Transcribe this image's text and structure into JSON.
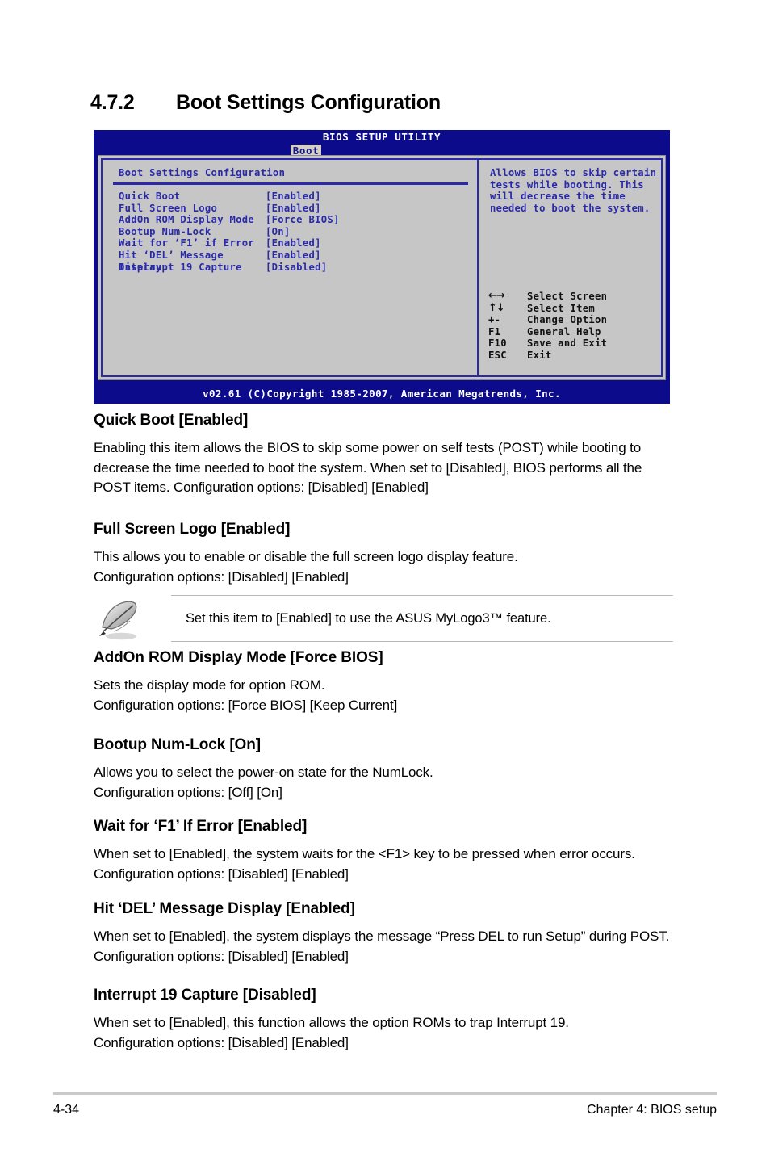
{
  "section": {
    "number": "4.7.2",
    "title": "Boot Settings Configuration"
  },
  "bios": {
    "title": "BIOS SETUP UTILITY",
    "tab": "Boot",
    "panel_heading": "Boot Settings Configuration",
    "settings": [
      {
        "label": "Quick Boot",
        "value": "[Enabled]"
      },
      {
        "label": "Full Screen Logo",
        "value": "[Enabled]"
      },
      {
        "label": "AddOn ROM Display Mode",
        "value": "[Force BIOS]"
      },
      {
        "label": "Bootup Num-Lock",
        "value": "[On]"
      },
      {
        "label": "Wait for ‘F1’ if Error",
        "value": "[Enabled]"
      },
      {
        "label": "Hit ‘DEL’ Message Display",
        "value": "[Enabled]"
      },
      {
        "label": "Interrupt 19 Capture",
        "value": "[Disabled]"
      }
    ],
    "help": "Allows BIOS to skip certain tests while booting. This will decrease the time needed to boot the system.",
    "legend": [
      {
        "key": "←→",
        "desc": "Select Screen",
        "icon": "left-right-arrow-icon"
      },
      {
        "key": "↑↓",
        "desc": "Select Item",
        "icon": "up-down-arrow-icon"
      },
      {
        "key": "+-",
        "desc": "Change Option",
        "icon": "plus-minus-icon"
      },
      {
        "key": "F1",
        "desc": "General Help",
        "icon": ""
      },
      {
        "key": "F10",
        "desc": "Save and Exit",
        "icon": ""
      },
      {
        "key": "ESC",
        "desc": "Exit",
        "icon": ""
      }
    ],
    "footer": "v02.61 (C)Copyright 1985-2007, American Megatrends, Inc.",
    "colors": {
      "chrome_blue": "#0b0b8c",
      "panel_gray": "#c6c6c6",
      "text_blue": "#2a2aa8",
      "tab_bg": "#d4d0c8"
    }
  },
  "items": [
    {
      "heading": "Quick Boot [Enabled]",
      "body": "Enabling this item allows the BIOS to skip some power on self tests (POST) while booting to decrease the time needed to boot the system. When set to [Disabled], BIOS performs all the POST items. Configuration options: [Disabled] [Enabled]"
    },
    {
      "heading": "Full Screen Logo [Enabled]",
      "body": "This allows you to enable or disable the full screen logo display feature.\nConfiguration options: [Disabled] [Enabled]"
    },
    {
      "heading": "AddOn ROM Display Mode [Force BIOS]",
      "body": "Sets the display mode for option ROM.\nConfiguration options: [Force BIOS] [Keep Current]"
    },
    {
      "heading": "Bootup Num-Lock [On]",
      "body": "Allows you to select the power-on state for the NumLock.\nConfiguration options: [Off] [On]"
    },
    {
      "heading": "Wait for ‘F1’ If Error [Enabled]",
      "body": "When set to [Enabled], the system waits for the <F1> key to be pressed when error occurs. Configuration options: [Disabled] [Enabled]"
    },
    {
      "heading": "Hit ‘DEL’ Message Display [Enabled]",
      "body": "When set to [Enabled], the system displays the message “Press DEL to run Setup” during POST. Configuration options: [Disabled] [Enabled]"
    },
    {
      "heading": "Interrupt 19 Capture [Disabled]",
      "body": "When set to [Enabled], this function allows the option ROMs to trap Interrupt 19.\nConfiguration options: [Disabled] [Enabled]"
    }
  ],
  "note": {
    "icon": "quill-pen-icon",
    "text": "Set this item to [Enabled] to use the ASUS MyLogo3™ feature."
  },
  "page_footer": {
    "page_number": "4-34",
    "chapter": "Chapter 4: BIOS setup"
  }
}
